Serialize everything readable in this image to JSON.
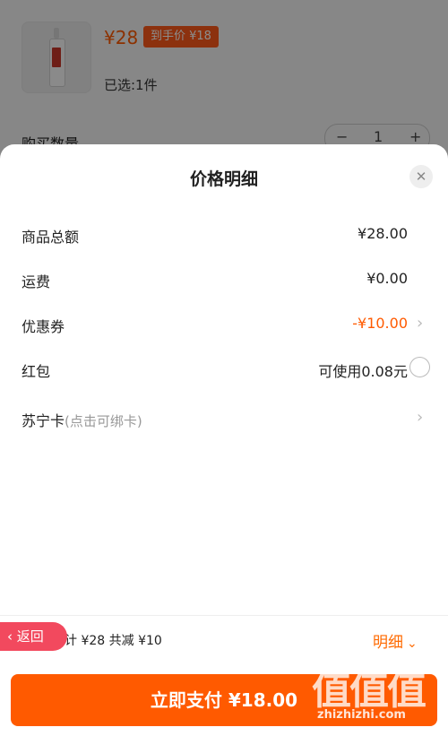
{
  "product": {
    "price": "¥28",
    "final_price_tag": "到手价 ¥18",
    "selected": "已选:1件",
    "quantity_label": "购买数量",
    "quantity": "1",
    "minus": "−",
    "plus": "+"
  },
  "sheet": {
    "title": "价格明细",
    "close_icon": "close-icon",
    "rows": [
      {
        "label": "商品总额",
        "value": "¥28.00"
      },
      {
        "label": "运费",
        "value": "¥0.00"
      },
      {
        "label": "优惠券",
        "value": "-¥10.00"
      },
      {
        "label": "红包",
        "value": "可使用0.08元"
      },
      {
        "label": "苏宁卡",
        "hint": "(点击可绑卡)"
      }
    ]
  },
  "footer": {
    "back_label": "返回",
    "summary": "计 ¥28  共减 ¥10",
    "detail_label": "明细",
    "pay_label": "立即支付 ¥18.00"
  },
  "watermark": {
    "big": "值值值",
    "small": "zhizhizhi.com"
  },
  "colors": {
    "accent": "#ff5a00",
    "back_button": "#f2495e"
  }
}
